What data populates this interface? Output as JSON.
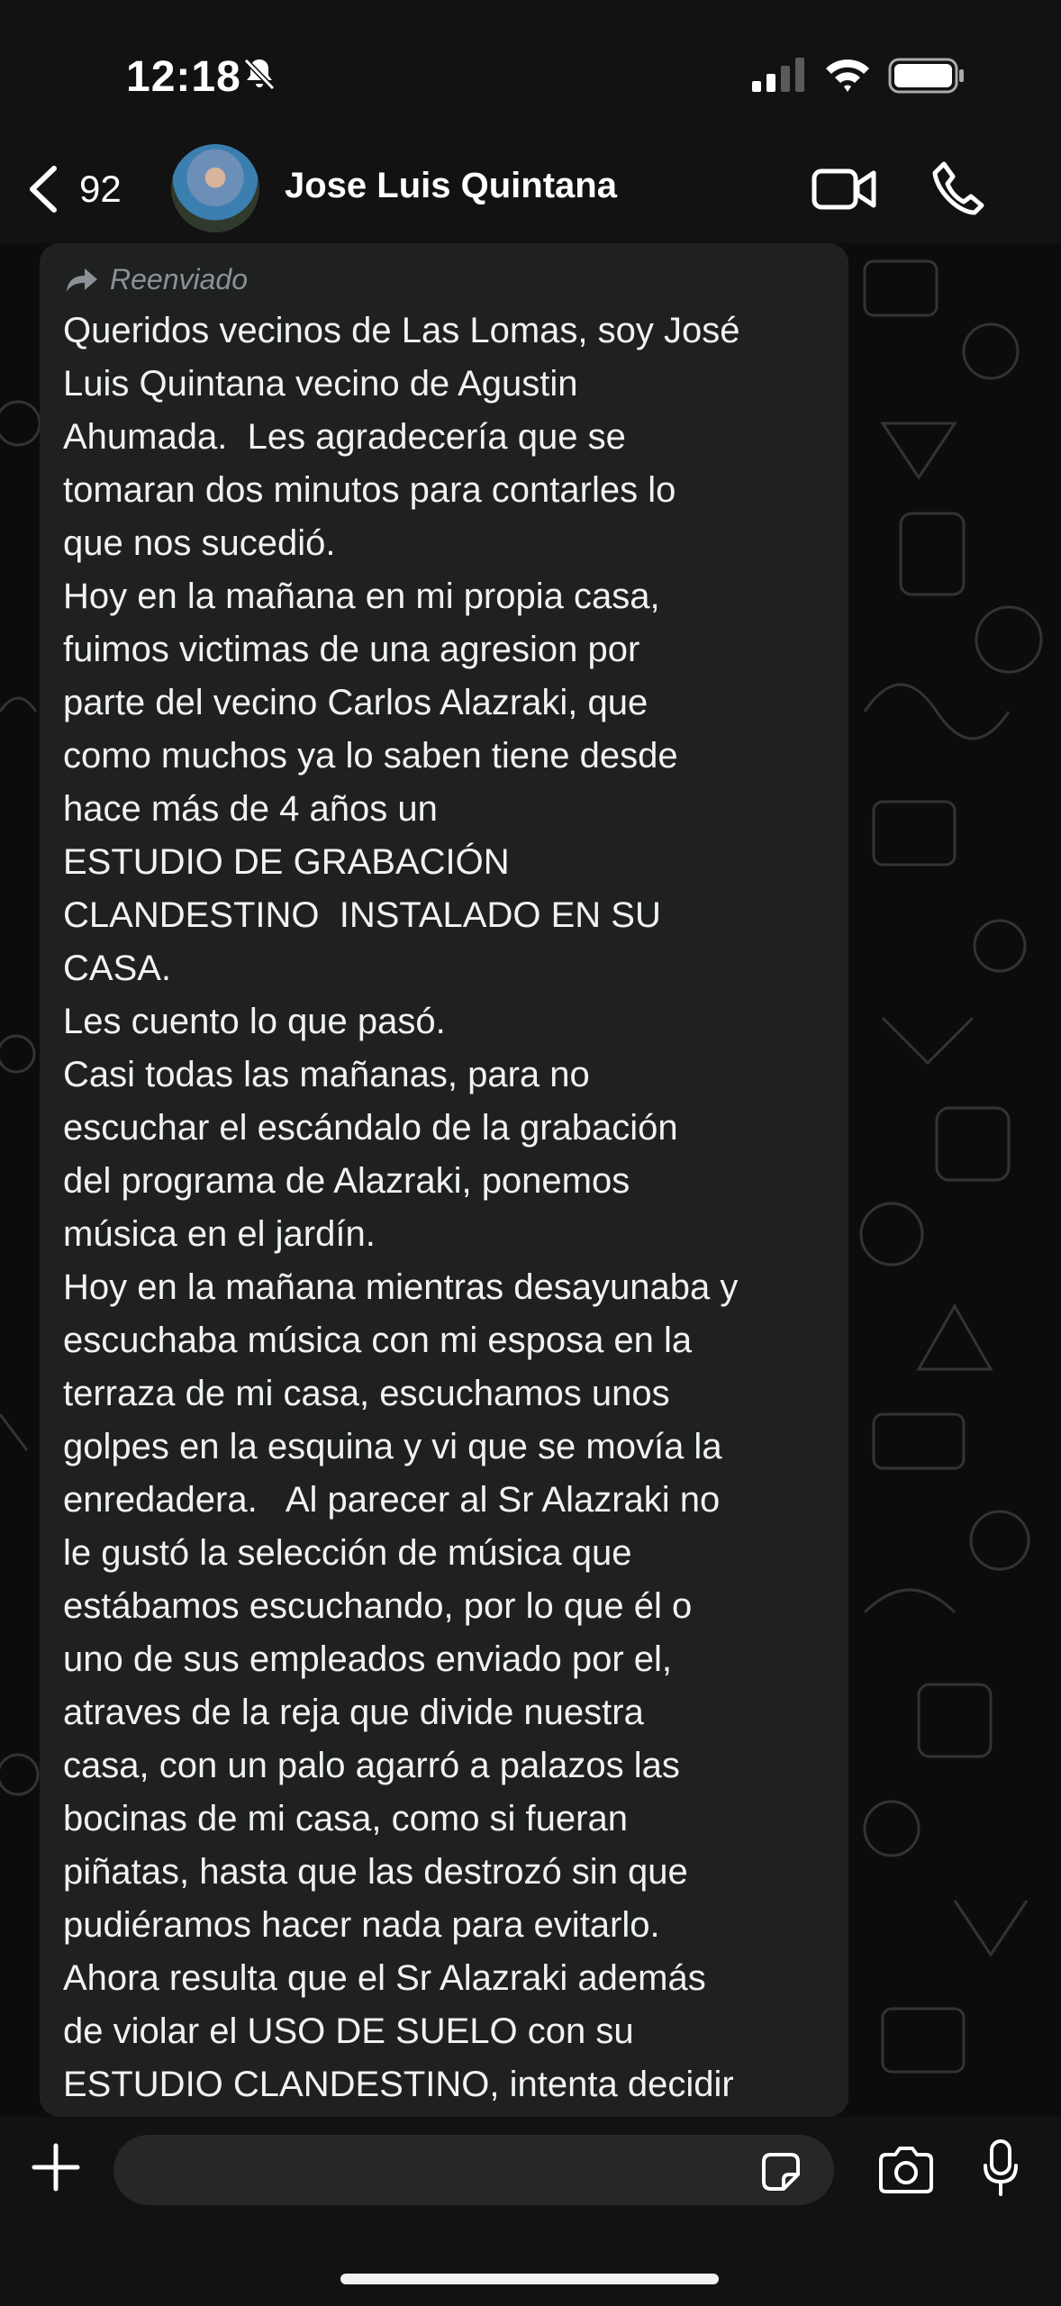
{
  "status_bar": {
    "time": "12:18",
    "icons": [
      "bell-slash-icon",
      "cellular-signal-icon",
      "wifi-icon",
      "battery-icon"
    ]
  },
  "header": {
    "back_count": "92",
    "contact_name": "Jose Luis Quintana",
    "icons": [
      "chevron-left-icon",
      "video-camera-icon",
      "phone-icon"
    ]
  },
  "message": {
    "forwarded_label": "Reenviado",
    "text": "Queridos vecinos de Las Lomas, soy José\nLuis Quintana vecino de Agustin\nAhumada.  Les agradecería que se\ntomaran dos minutos para contarles lo\nque nos sucedió.\nHoy en la mañana en mi propia casa,\nfuimos victimas de una agresion por\nparte del vecino Carlos Alazraki, que\ncomo muchos ya lo saben tiene desde\nhace más de 4 años un\nESTUDIO DE GRABACIÓN\nCLANDESTINO  INSTALADO EN SU\nCASA.\nLes cuento lo que pasó.\nCasi todas las mañanas, para no\nescuchar el escándalo de la grabación\ndel programa de Alazraki, ponemos\nmúsica en el jardín.\nHoy en la mañana mientras desayunaba y\nescuchaba música con mi esposa en la\nterraza de mi casa, escuchamos unos\ngolpes en la esquina y vi que se movía la\nenredadera.   Al parecer al Sr Alazraki no\nle gustó la selección de música que\nestábamos escuchando, por lo que él o\nuno de sus empleados enviado por el,\natraves de la reja que divide nuestra\ncasa, con un palo agarró a palazos las\nbocinas de mi casa, como si fueran\npiñatas, hasta que las destrozó sin que\npudiéramos hacer nada para evitarlo.\nAhora resulta que el Sr Alazraki además\nde violar el USO DE SUELO con su\nESTUDIO CLANDESTINO, intenta decidir\nqué música pueden escuchar sus vecinos"
  },
  "input_bar": {
    "placeholder": "",
    "icons": [
      "plus-icon",
      "sticker-icon",
      "camera-icon",
      "microphone-icon",
      "chevron-down-icon"
    ]
  },
  "colors": {
    "background": "#0b0b0b",
    "bar": "#121212",
    "bubble": "#1f2121",
    "text": "#f0f2f3",
    "secondary_text": "#8b9297"
  }
}
